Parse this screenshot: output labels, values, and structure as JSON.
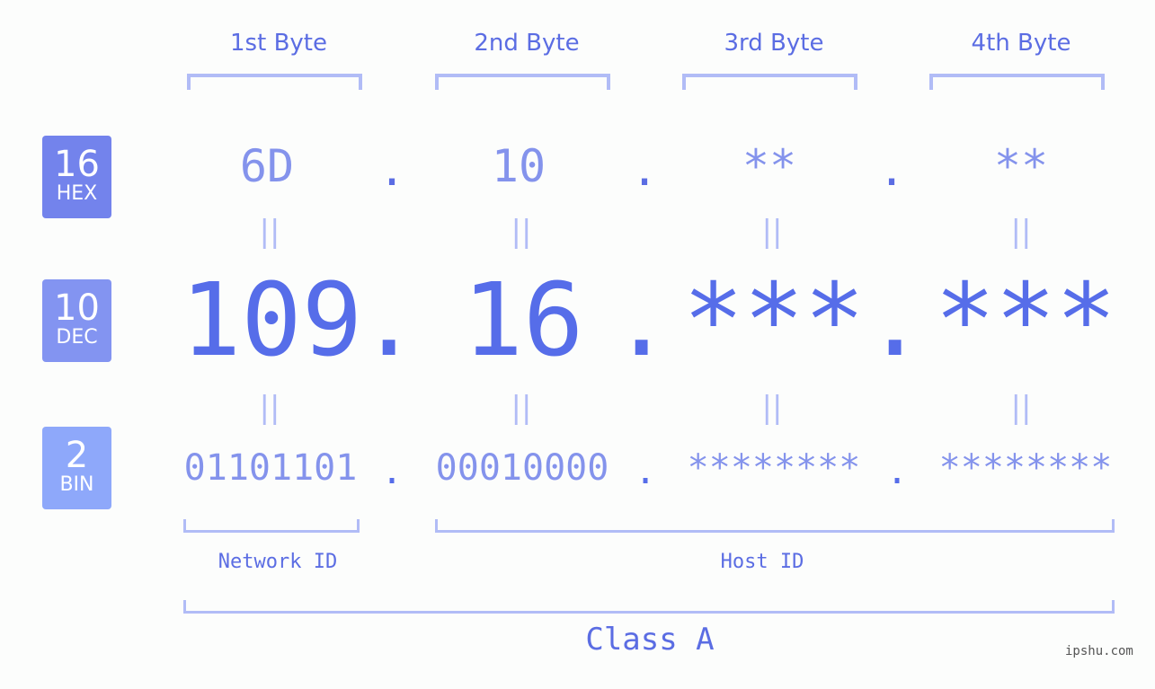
{
  "bytes": [
    {
      "label": "1st Byte",
      "hex": "6D",
      "dec": "109",
      "bin": "01101101"
    },
    {
      "label": "2nd Byte",
      "hex": "10",
      "dec": "16",
      "bin": "00010000"
    },
    {
      "label": "3rd Byte",
      "hex": "**",
      "dec": "***",
      "bin": "********"
    },
    {
      "label": "4th Byte",
      "hex": "**",
      "dec": "***",
      "bin": "********"
    }
  ],
  "separator": ".",
  "equals": "||",
  "badges": {
    "hex": {
      "num": "16",
      "label": "HEX",
      "color": "#7383ec"
    },
    "dec": {
      "num": "10",
      "label": "DEC",
      "color": "#8394f1"
    },
    "bin": {
      "num": "2",
      "label": "BIN",
      "color": "#8ea8fa"
    }
  },
  "network_id_label": "Network ID",
  "host_id_label": "Host ID",
  "class_label": "Class A",
  "footer": "ipshu.com"
}
